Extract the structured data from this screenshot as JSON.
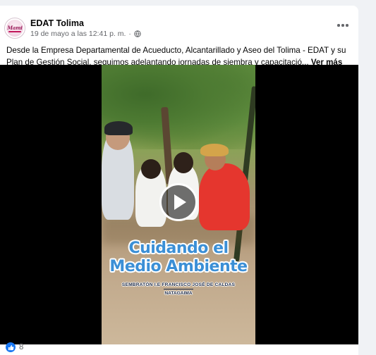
{
  "post": {
    "page_name": "EDAT Tolima",
    "timestamp": "19 de mayo a las 12:41 p. m.",
    "separator": "·",
    "audience_icon": "globe-icon",
    "avatar_logo_text": "Mami",
    "text": "Desde la Empresa Departamental de Acueducto, Alcantarillado y Aseo del Tolima - EDAT y su Plan de Gestión Social, seguimos adelantando jornadas de siembra y capacitació...",
    "see_more_label": "Ver más"
  },
  "video": {
    "headline_line1": "Cuidando el",
    "headline_line2": "Medio Ambiente",
    "subtitle_line1": "SEMBRATÓN I.E FRANCISCO JOSÉ DE CALDAS",
    "subtitle_line2": "NATAGAIMA",
    "headline_color": "#3b8fd6"
  },
  "reactions": {
    "icon": "like-icon",
    "count": "8",
    "color": "#1877f2"
  }
}
